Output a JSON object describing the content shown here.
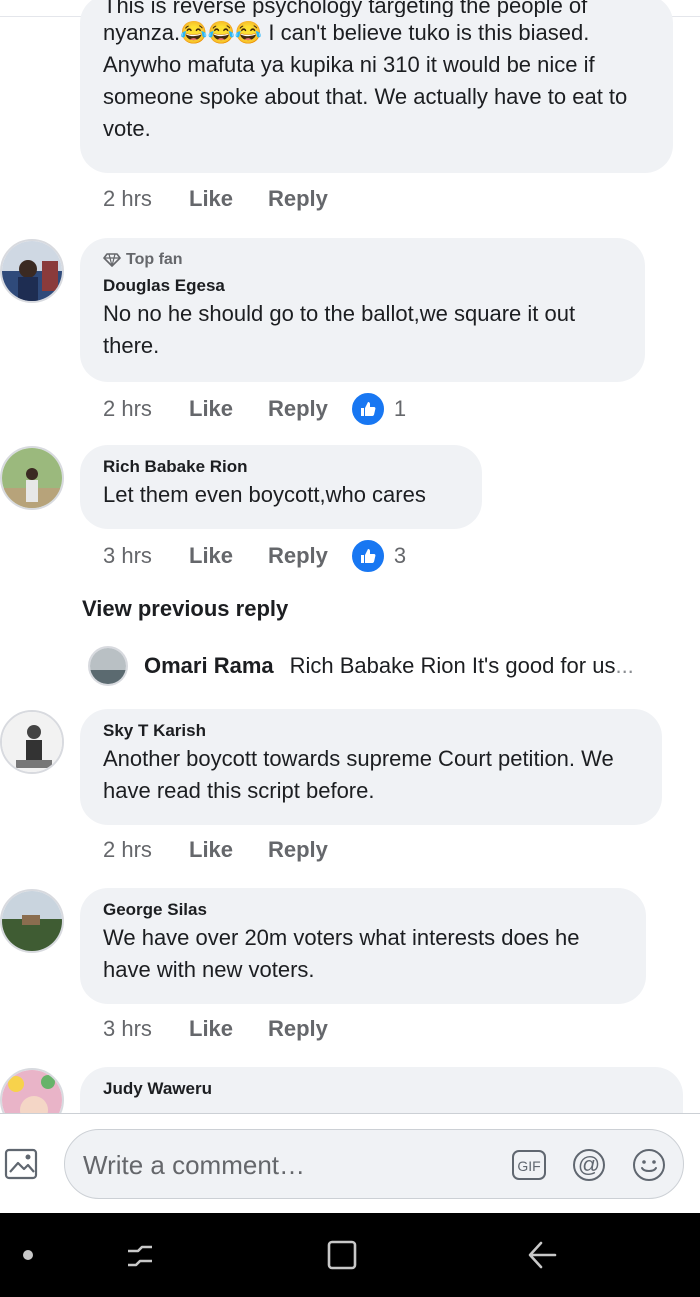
{
  "comments": [
    {
      "partial_first_line": "This is reverse psychology targeting the people of",
      "text_prefix": "nyanza.",
      "emojis": [
        "😂",
        "😂",
        "😂"
      ],
      "text": " I can't believe tuko is this biased. Anywho mafuta ya kupika ni 310 it would be nice if someone spoke about that. We actually have to eat to vote.",
      "time": "2 hrs",
      "like": "Like",
      "reply": "Reply"
    },
    {
      "badge": "Top fan",
      "author": "Douglas Egesa",
      "text": "No no he should go to the ballot,we square it out there.",
      "time": "2 hrs",
      "like": "Like",
      "reply": "Reply",
      "reactions": "1"
    },
    {
      "author": "Rich Babake Rion",
      "text": "Let them even boycott,who cares",
      "time": "3 hrs",
      "like": "Like",
      "reply": "Reply",
      "reactions": "3"
    },
    {
      "author": "Sky T Karish",
      "text": "Another  boycott towards supreme Court petition. We have read this script before.",
      "time": "2 hrs",
      "like": "Like",
      "reply": "Reply"
    },
    {
      "author": "George Silas",
      "text": "We have over 20m voters what interests does he have with new voters.",
      "time": "3 hrs",
      "like": "Like",
      "reply": "Reply"
    },
    {
      "author": "Judy Waweru"
    }
  ],
  "view_previous_reply": "View previous reply",
  "reply_preview": {
    "author": "Omari Rama",
    "text": "Rich Babake Rion It's good for us",
    "ellipsis": "..."
  },
  "composer": {
    "placeholder": "Write a comment…",
    "icons": [
      "photo-icon",
      "gif-icon",
      "mention-icon",
      "emoji-icon"
    ]
  },
  "navbar": {
    "icons": [
      "dot-icon",
      "recent-apps-icon",
      "home-icon",
      "back-icon"
    ]
  },
  "colors": {
    "bubble": "#f0f2f5",
    "like_blue": "#1877f2",
    "secondary_text": "#65676b",
    "navbar": "#000000"
  }
}
